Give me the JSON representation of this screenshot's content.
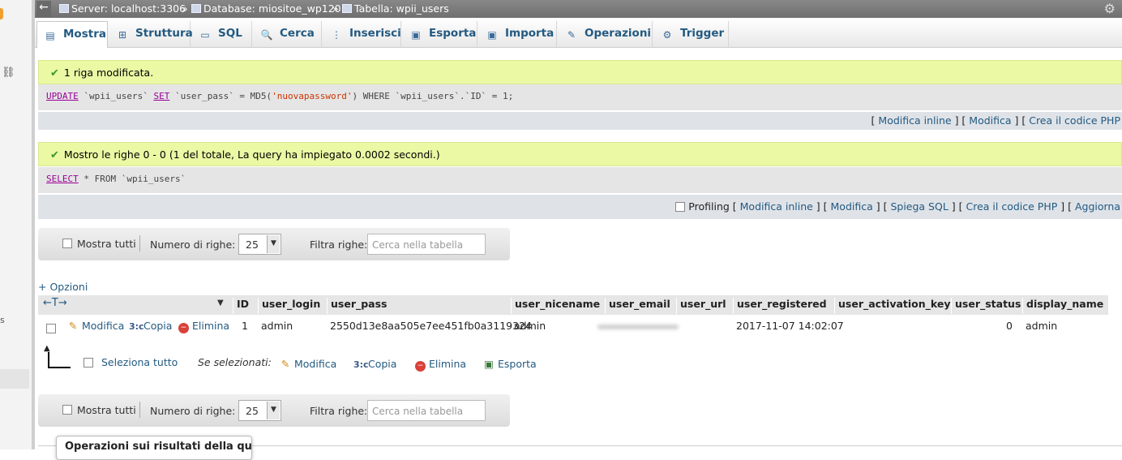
{
  "breadcrumb": {
    "server": "Server: localhost:3306",
    "database": "Database: miositoe_wp120",
    "table": "Tabella: wpii_users",
    "separator": "»"
  },
  "tabs": [
    {
      "label": "Mostra",
      "icon": "browse-icon",
      "glyph": "▤"
    },
    {
      "label": "Struttura",
      "icon": "structure-icon",
      "glyph": "⊞"
    },
    {
      "label": "SQL",
      "icon": "sql-icon",
      "glyph": "▭"
    },
    {
      "label": "Cerca",
      "icon": "search-icon",
      "glyph": "🔍"
    },
    {
      "label": "Inserisci",
      "icon": "insert-icon",
      "glyph": "⋮"
    },
    {
      "label": "Esporta",
      "icon": "export-icon",
      "glyph": "▣"
    },
    {
      "label": "Importa",
      "icon": "import-icon",
      "glyph": "▣"
    },
    {
      "label": "Operazioni",
      "icon": "wrench-icon",
      "glyph": "✎"
    },
    {
      "label": "Trigger",
      "icon": "trigger-icon",
      "glyph": "⚙"
    }
  ],
  "message1": {
    "text": "1 riga modificata.",
    "sql": {
      "kw1": "UPDATE",
      "t1": " `wpii_users` ",
      "kw2": "SET",
      "t2": " `user_pass` = MD5(",
      "str": "'nuovapassword'",
      "t3": ") WHERE `wpii_users`.`ID` = 1;"
    },
    "links": {
      "inline": "Modifica inline",
      "edit": "Modifica",
      "php": "Crea il codice PHP"
    }
  },
  "message2": {
    "text": "Mostro le righe 0 - 0 (1 del totale, La query ha impiegato 0.0002 secondi.)",
    "sql": {
      "kw1": "SELECT",
      "t1": " * FROM `wpii_users`"
    },
    "profiling": "Profiling",
    "links": {
      "inline": "Modifica inline",
      "edit": "Modifica",
      "explain": "Spiega SQL",
      "php": "Crea il codice PHP",
      "refresh": "Aggiorna"
    }
  },
  "nav": {
    "show_all": "Mostra tutti",
    "rows_label": "Numero di righe:",
    "rows_value": "25",
    "filter_label": "Filtra righe:",
    "filter_placeholder": "Cerca nella tabella"
  },
  "options_link": "+ Opzioni",
  "table": {
    "columns": [
      "ID",
      "user_login",
      "user_pass",
      "user_nicename",
      "user_email",
      "user_url",
      "user_registered",
      "user_activation_key",
      "user_status",
      "display_name"
    ],
    "row_actions": {
      "edit": "Modifica",
      "copy": "Copia",
      "delete": "Elimina"
    },
    "rows": [
      {
        "ID": "1",
        "user_login": "admin",
        "user_pass": "2550d13e8aa505e7ee451fb0a3119324",
        "user_nicename": "admin",
        "user_email": "",
        "user_url": "",
        "user_registered": "2017-11-07 14:02:07",
        "user_activation_key": "",
        "user_status": "0",
        "display_name": "admin"
      }
    ]
  },
  "bulk": {
    "select_all": "Seleziona tutto",
    "with_selected": "Se selezionati:",
    "edit": "Modifica",
    "copy": "Copia",
    "delete": "Elimina",
    "export": "Esporta"
  },
  "query_ops": "Operazioni sui risultati della query",
  "colors": {
    "success_bg": "#ebf8a4",
    "link": "#235a81",
    "sql_keyword": "#990099"
  }
}
